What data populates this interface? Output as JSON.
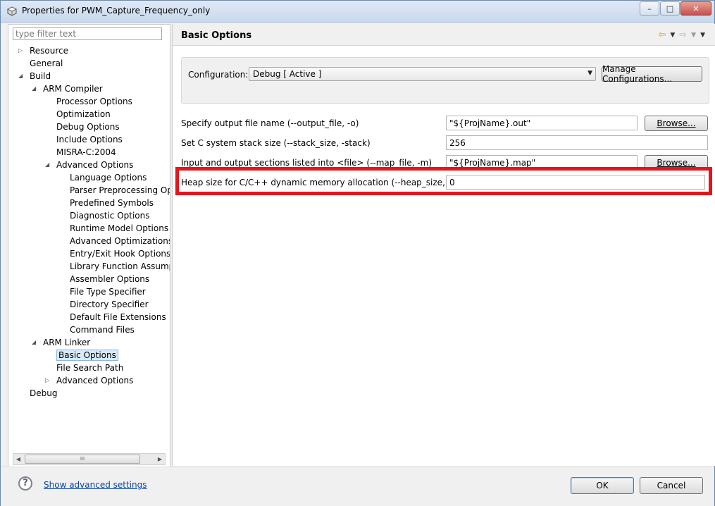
{
  "window": {
    "title": "Properties for PWM_Capture_Frequency_only",
    "minimize_glyph": "–",
    "maximize_glyph": "□",
    "close_glyph": "✕"
  },
  "filter": {
    "placeholder": "type filter text"
  },
  "tree": {
    "items": [
      {
        "label": "Resource",
        "level": 0,
        "arrow": "collapsed"
      },
      {
        "label": "General",
        "level": 0,
        "arrow": "none"
      },
      {
        "label": "Build",
        "level": 0,
        "arrow": "expanded"
      },
      {
        "label": "ARM Compiler",
        "level": 1,
        "arrow": "expanded"
      },
      {
        "label": "Processor Options",
        "level": 2,
        "arrow": "none"
      },
      {
        "label": "Optimization",
        "level": 2,
        "arrow": "none"
      },
      {
        "label": "Debug Options",
        "level": 2,
        "arrow": "none"
      },
      {
        "label": "Include Options",
        "level": 2,
        "arrow": "none"
      },
      {
        "label": "MISRA-C:2004",
        "level": 2,
        "arrow": "none"
      },
      {
        "label": "Advanced Options",
        "level": 2,
        "arrow": "expanded"
      },
      {
        "label": "Language Options",
        "level": 3,
        "arrow": "none"
      },
      {
        "label": "Parser Preprocessing Opti",
        "level": 3,
        "arrow": "none"
      },
      {
        "label": "Predefined Symbols",
        "level": 3,
        "arrow": "none"
      },
      {
        "label": "Diagnostic Options",
        "level": 3,
        "arrow": "none"
      },
      {
        "label": "Runtime Model Options",
        "level": 3,
        "arrow": "none"
      },
      {
        "label": "Advanced Optimizations",
        "level": 3,
        "arrow": "none"
      },
      {
        "label": "Entry/Exit Hook Options",
        "level": 3,
        "arrow": "none"
      },
      {
        "label": "Library Function Assumpt",
        "level": 3,
        "arrow": "none"
      },
      {
        "label": "Assembler Options",
        "level": 3,
        "arrow": "none"
      },
      {
        "label": "File Type Specifier",
        "level": 3,
        "arrow": "none"
      },
      {
        "label": "Directory Specifier",
        "level": 3,
        "arrow": "none"
      },
      {
        "label": "Default File Extensions",
        "level": 3,
        "arrow": "none"
      },
      {
        "label": "Command Files",
        "level": 3,
        "arrow": "none"
      },
      {
        "label": "ARM Linker",
        "level": 1,
        "arrow": "expanded"
      },
      {
        "label": "Basic Options",
        "level": 2,
        "arrow": "none",
        "selected": true
      },
      {
        "label": "File Search Path",
        "level": 2,
        "arrow": "none"
      },
      {
        "label": "Advanced Options",
        "level": 2,
        "arrow": "collapsed"
      },
      {
        "label": "Debug",
        "level": 0,
        "arrow": "none"
      }
    ]
  },
  "hscroll": {
    "thumb_glyph": "III"
  },
  "page": {
    "title": "Basic Options",
    "configuration_label": "Configuration:",
    "configuration_value": "Debug  [ Active ]",
    "manage_button": "Manage Configurations...",
    "rows": [
      {
        "label": "Specify output file name (--output_file, -o)",
        "value": "\"${ProjName}.out\"",
        "browse": "Browse..."
      },
      {
        "label": "Set C system stack size (--stack_size, -stack)",
        "value": "256",
        "browse": ""
      },
      {
        "label": "Input and output sections listed into <file> (--map_file, -m)",
        "value": "\"${ProjName}.map\"",
        "browse": "Browse..."
      },
      {
        "label": "Heap size for C/C++ dynamic memory allocation (--heap_size, -heap)",
        "value": "0",
        "browse": ""
      }
    ]
  },
  "footer": {
    "help_glyph": "?",
    "advanced_link": "Show advanced settings",
    "ok": "OK",
    "cancel": "Cancel"
  },
  "colors": {
    "highlight": "#e6141b",
    "selection": "#d8e9fb",
    "link": "#0645ad"
  }
}
